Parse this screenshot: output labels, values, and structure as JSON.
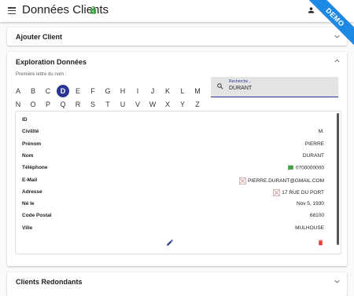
{
  "app": {
    "title": "Données Clients",
    "ribbon": "DEMO"
  },
  "panels": {
    "add_client": {
      "title": "Ajouter Client"
    },
    "exploration": {
      "title": "Exploration Données"
    },
    "redundant": {
      "title": "Clients Redondants"
    }
  },
  "alphabet": {
    "label": "Première lettre du nom :",
    "row1": [
      "A",
      "B",
      "C",
      "D",
      "E",
      "F",
      "G",
      "H",
      "I",
      "J",
      "K",
      "L",
      "M"
    ],
    "row2": [
      "N",
      "O",
      "P",
      "Q",
      "R",
      "S",
      "T",
      "U",
      "V",
      "W",
      "X",
      "Y",
      "Z"
    ],
    "selected": "D"
  },
  "search": {
    "label": "Recherche...",
    "value": "DURANT"
  },
  "record": {
    "fields": [
      {
        "label": "ID",
        "value": ""
      },
      {
        "label": "Civilité",
        "value": "M."
      },
      {
        "label": "Prénom",
        "value": "PIERRE"
      },
      {
        "label": "Nom",
        "value": "DURANT"
      },
      {
        "label": "Téléphone",
        "value": "0700000000",
        "icon": "message-icon"
      },
      {
        "label": "E-Mail",
        "value": "PIERRE.DURANT@GMAIL.COM",
        "icon": "broken-image-icon"
      },
      {
        "label": "Adresse",
        "value": "17 RUE DU PORT",
        "icon": "broken-image-icon"
      },
      {
        "label": "Né le",
        "value": "Nov 5, 1930"
      },
      {
        "label": "Code Postal",
        "value": "68100"
      },
      {
        "label": "Ville",
        "value": "MULHOUSE"
      }
    ]
  },
  "colors": {
    "accent": "#283593",
    "ribbon": "#1e88e5",
    "delete": "#e53935",
    "message": "#43a047",
    "lock": "#43a047"
  }
}
